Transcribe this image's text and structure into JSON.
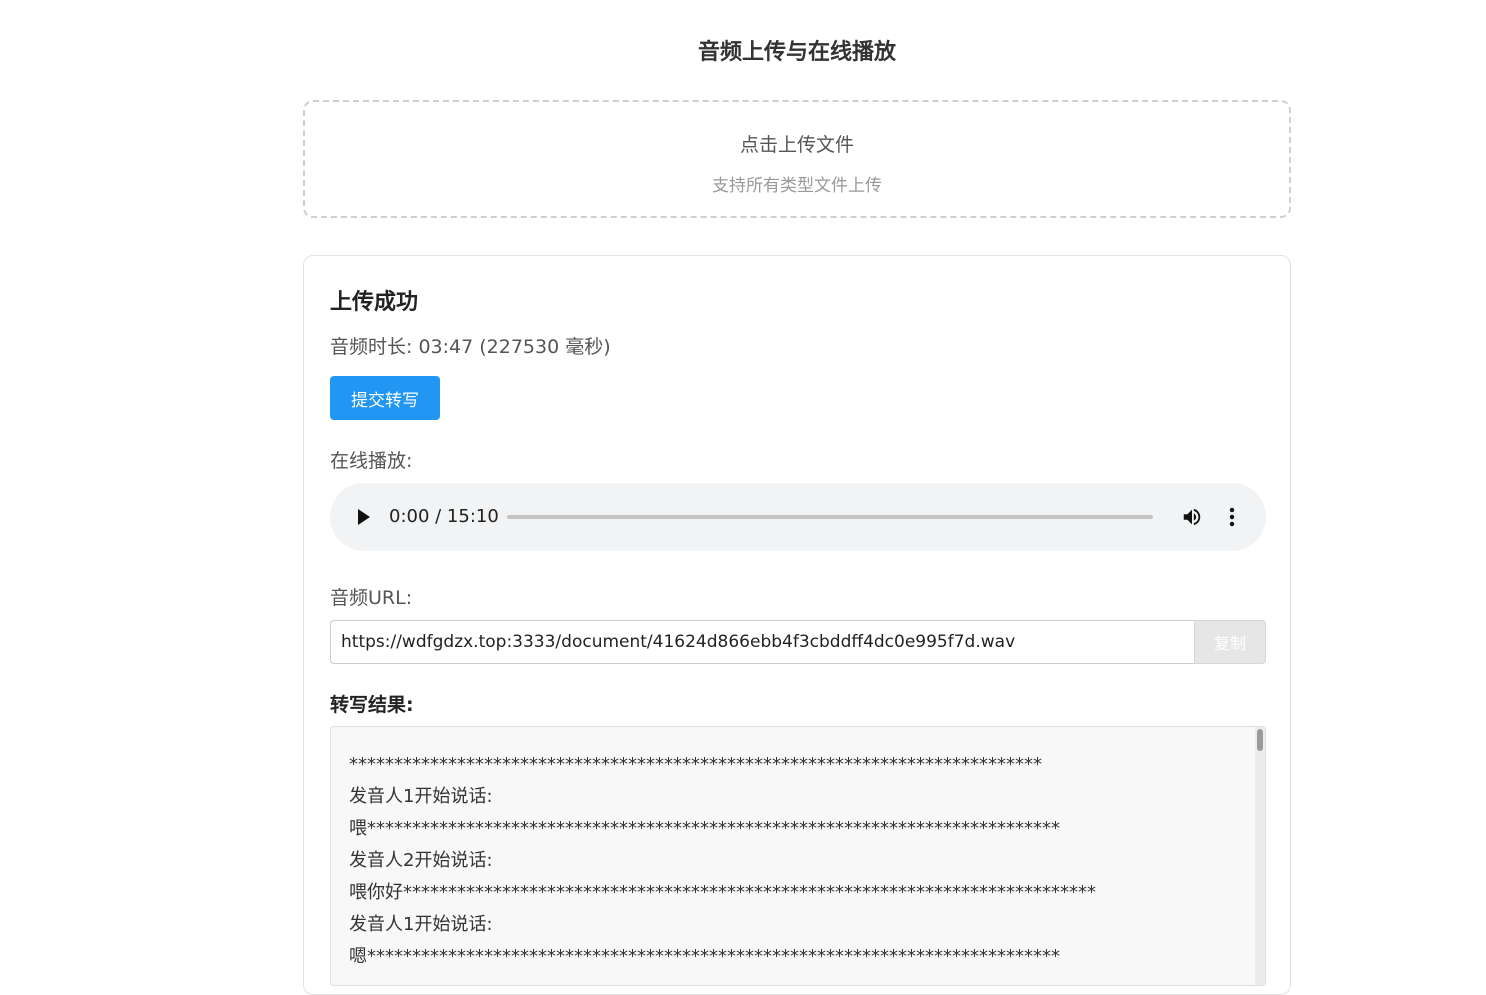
{
  "page_title": "音频上传与在线播放",
  "upload": {
    "title": "点击上传文件",
    "subtitle": "支持所有类型文件上传"
  },
  "result": {
    "title": "上传成功",
    "duration": "音频时长: 03:47 (227530 毫秒)",
    "submit_label": "提交转写",
    "play_label": "在线播放:",
    "player": {
      "time": "0:00 / 15:10",
      "progress": 0
    },
    "url_label": "音频URL:",
    "url_value": "https://wdfgdzx.top:3333/document/41624d866ebb4f3cbddff4dc0e995f7d.wav",
    "copy_label": "复制",
    "transcript_label": "转写结果:",
    "transcript_lines": [
      "*****************************************************************************",
      "发音人1开始说话:",
      "喂*****************************************************************************",
      "发音人2开始说话:",
      "喂你好*****************************************************************************",
      "发音人1开始说话:",
      "嗯*****************************************************************************"
    ]
  },
  "colors": {
    "accent": "#2196f3",
    "player_bg": "#f1f3f4"
  }
}
